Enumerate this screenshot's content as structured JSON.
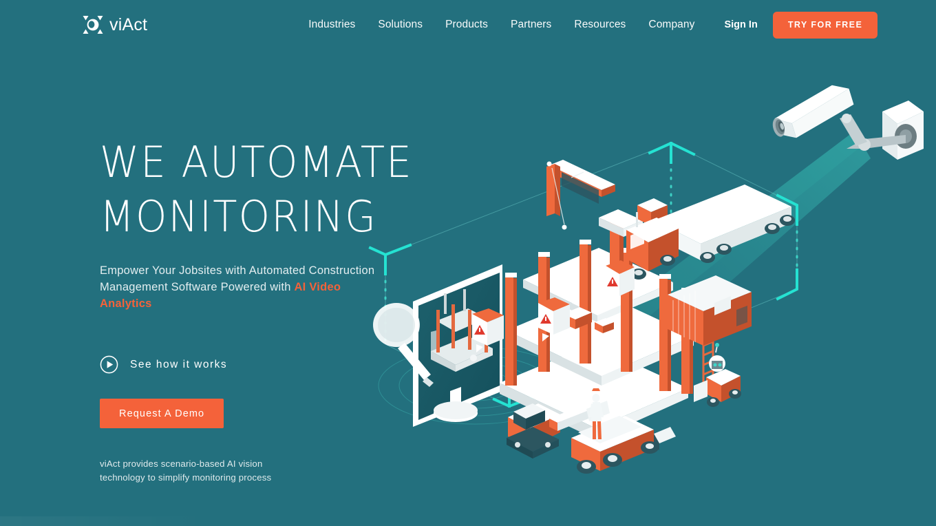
{
  "brand": {
    "name": "viAct",
    "logo_icon": "viact-eye-logo-icon",
    "background_color": "#23707e",
    "accent_color": "#f4623a",
    "highlight_color": "#27e0d0"
  },
  "header": {
    "nav": [
      {
        "label": "Industries"
      },
      {
        "label": "Solutions"
      },
      {
        "label": "Products"
      },
      {
        "label": "Partners"
      },
      {
        "label": "Resources"
      },
      {
        "label": "Company"
      }
    ],
    "sign_in_label": "Sign In",
    "cta_label": "TRY FOR FREE"
  },
  "hero": {
    "headline": "WE AUTOMATE\nMONITORING",
    "subhead_prefix": "Empower Your Jobsites with Automated Construction Management Software Powered with ",
    "subhead_accent": "AI Video Analytics",
    "video_link_label": "See how it works",
    "video_icon": "play-circle-icon",
    "demo_button_label": "Request A Demo",
    "tagline": "viAct provides scenario-based AI vision technology to simplify monitoring process"
  },
  "illustration": {
    "alt": "Isometric construction site monitored by a CCTV camera with AI detection bounding box",
    "elements": [
      "cctv-camera",
      "camera-light-cone",
      "detection-bounding-box",
      "construction-building",
      "tower-crane",
      "semi-truck",
      "shipping-container",
      "excavator",
      "dump-truck",
      "worker",
      "monitor-screen",
      "magnifying-glass",
      "alert-bubble",
      "signal-ripples"
    ]
  }
}
